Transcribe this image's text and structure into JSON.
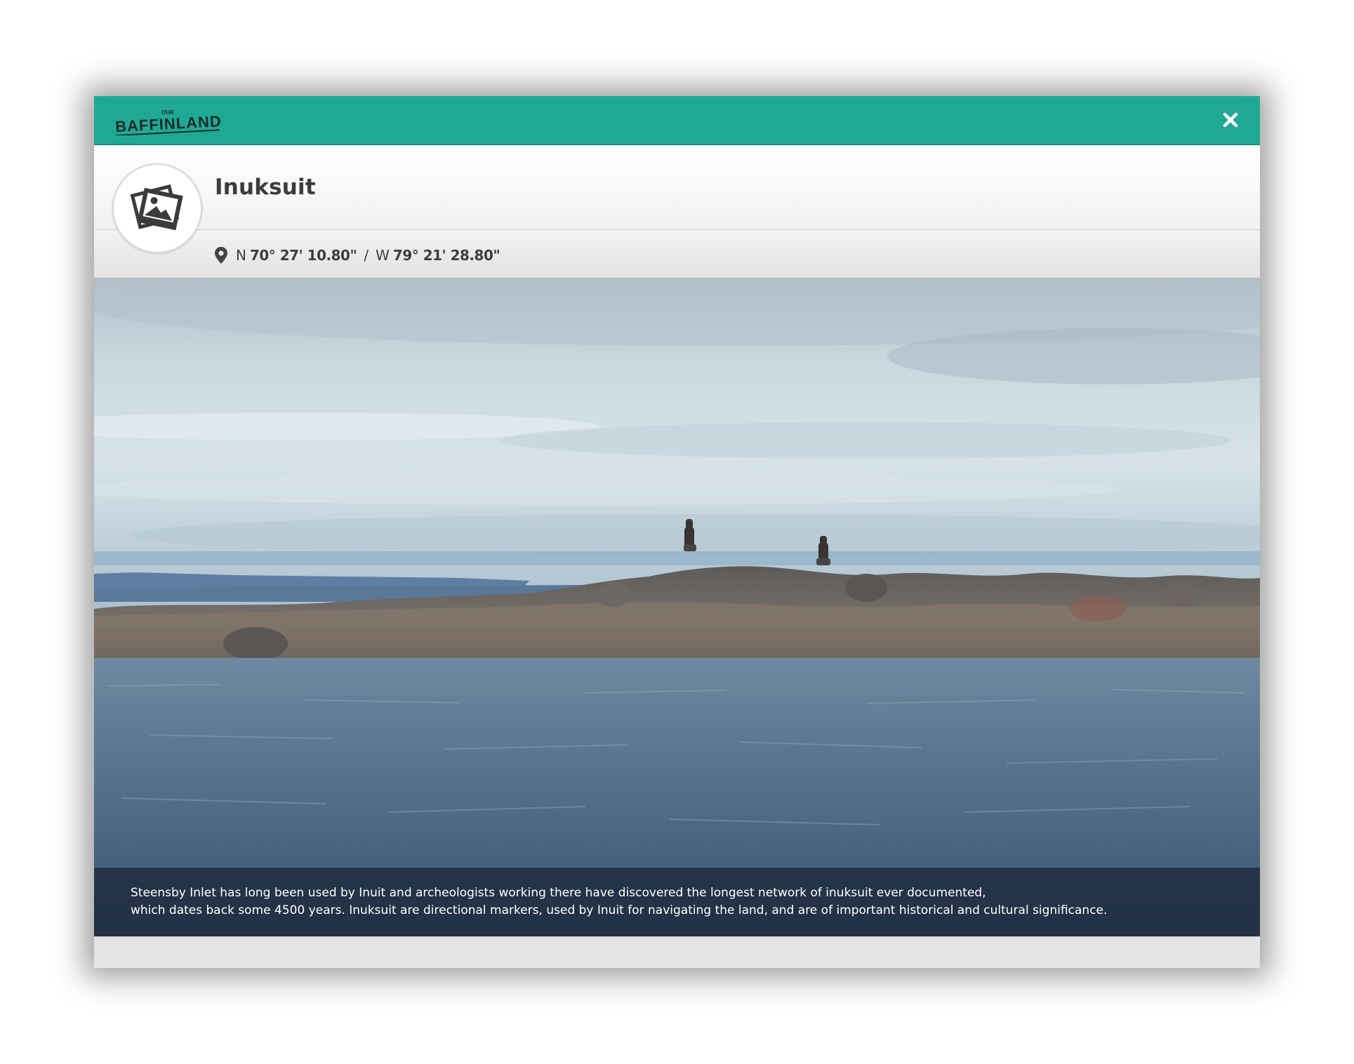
{
  "modal": {
    "logo": {
      "top_word": "OUR",
      "main_word": "BAFFINLAND"
    },
    "close_icon": "close-icon",
    "title": "Inuksuit",
    "avatar_icon": "photo-stack-icon",
    "location": {
      "pin_icon": "map-pin-icon",
      "lat_dir": "N",
      "lat_value": "70° 27' 10.80\"",
      "separator": "/",
      "lon_dir": "W",
      "lon_value": "79° 21' 28.80\""
    },
    "caption": {
      "line1": "Steensby Inlet has long been used by Inuit and archeologists working there have discovered the longest network of inuksuit ever documented,",
      "line2": "which dates back some 4500 years. Inuksuit are directional markers, used by Inuit for navigating the land, and are of important historical and cultural significance."
    },
    "colors": {
      "topbar": "#1fa995",
      "title_text": "#3c3c3c",
      "caption_bg": "#192434"
    }
  }
}
